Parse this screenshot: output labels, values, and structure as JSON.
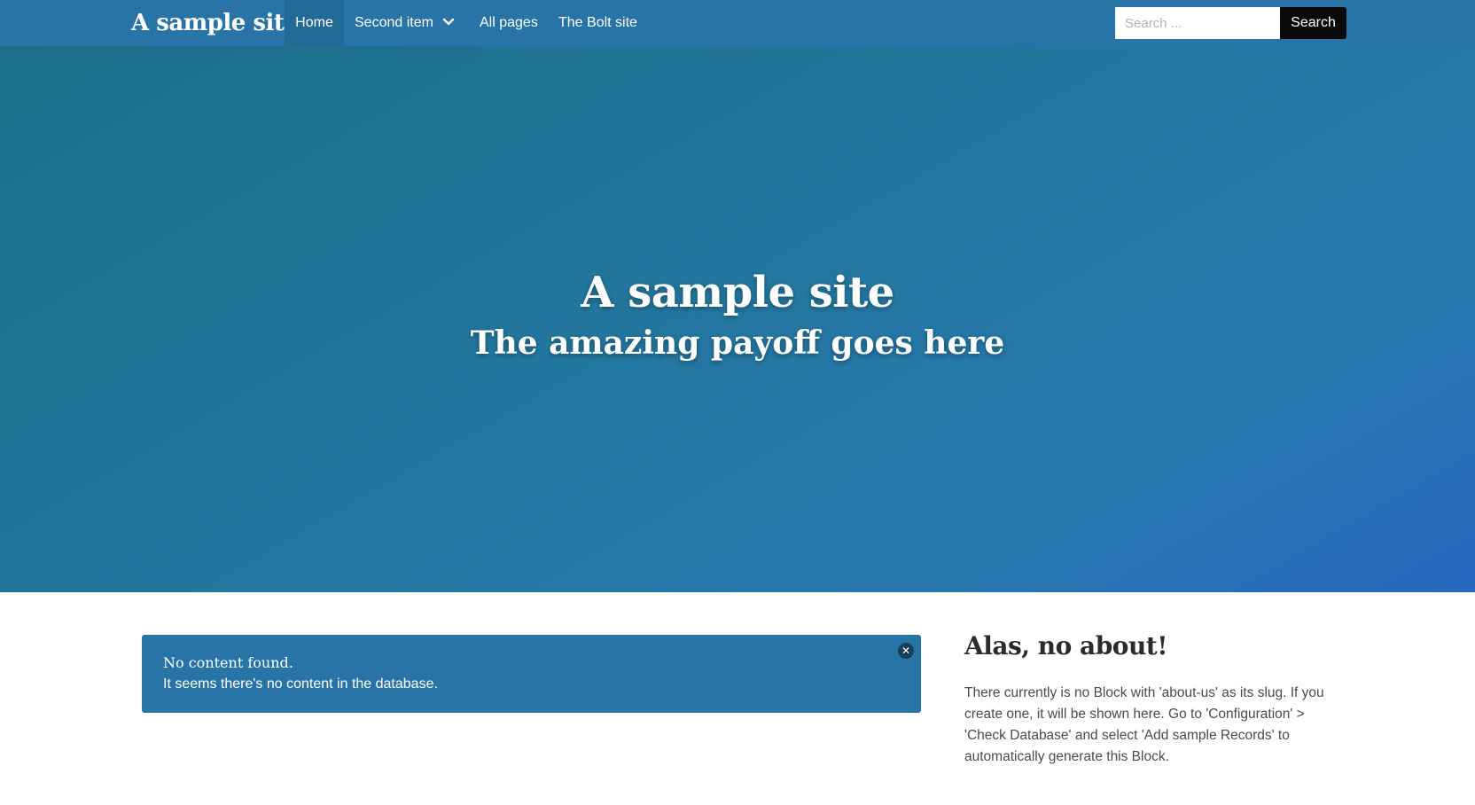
{
  "nav": {
    "brand": "A sample site",
    "items": [
      {
        "label": "Home",
        "active": true
      },
      {
        "label": "Second item",
        "dropdown": true
      },
      {
        "label": "All pages"
      },
      {
        "label": "The Bolt site"
      }
    ],
    "search": {
      "placeholder": "Search ...",
      "button_label": "Search"
    }
  },
  "hero": {
    "title": "A sample site",
    "subtitle": "The amazing payoff goes here"
  },
  "alert": {
    "title": "No content found.",
    "body": "It seems there's no content in the database.",
    "close_icon": "close-icon"
  },
  "about": {
    "title": "Alas, no about!",
    "text": "There currently is no Block with 'about-us' as its slug. If you create one, it will be shown here. Go to 'Configuration' > 'Check Database' and select 'Add sample Records' to automatically generate this Block."
  },
  "colors": {
    "navbar": "#2874a6",
    "hero_start": "#1c6f8a",
    "hero_end": "#2868c0",
    "alert": "#2874a6",
    "search_button": "#0a0a0a"
  }
}
